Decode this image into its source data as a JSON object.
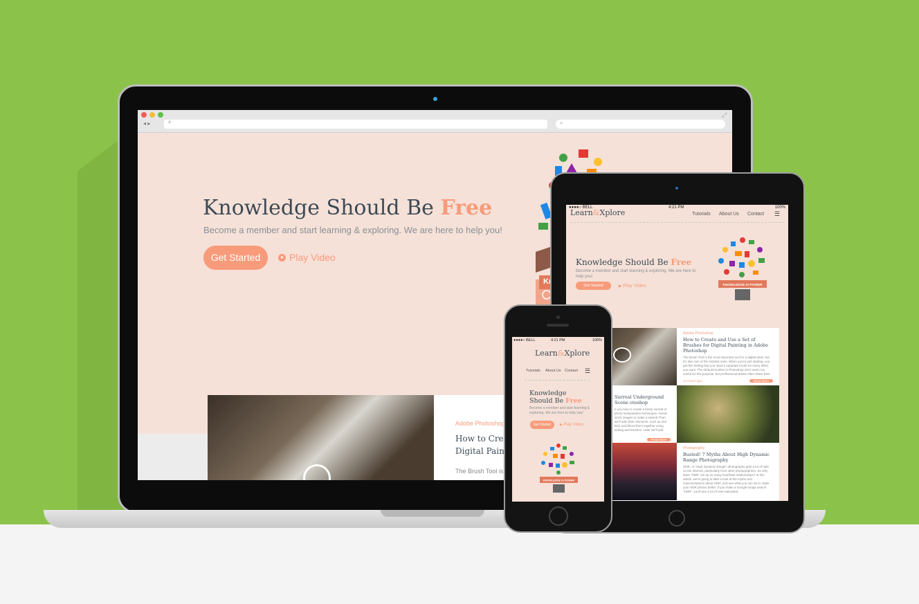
{
  "desktop": {
    "hero": {
      "title_main": "Knowledge Should Be ",
      "title_accent": "Free",
      "subtitle": "Become a member and start learning & exploring. We are here to help you!",
      "cta_label": "Get Started",
      "play_label": "Play Video"
    },
    "article": {
      "category": "Adobe Photoshop",
      "title_line1": "How to Crea",
      "title_line2": "Digital Paint",
      "excerpt": "The Brush Tool is t"
    },
    "badge": "Kn"
  },
  "tablet": {
    "status": {
      "carrier": "●●●●○ BELL",
      "time": "4:21 PM",
      "battery": "100%"
    },
    "logo_a": "Learn",
    "logo_amp": "&",
    "logo_b": "Xplore",
    "nav": [
      "Tutorials",
      "About Us",
      "Contact"
    ],
    "hero": {
      "title_main": "Knowledge Should Be ",
      "title_accent": "Free",
      "subtitle": "Become a member and start learning & exploring. We are here to help you!",
      "cta_label": "Get Started",
      "play_label": "Play Video",
      "badge": "KNOWLEDGE IS POWER"
    },
    "articles": [
      {
        "category": "Adobe Photoshop",
        "title": "How to Create and Use a Set of Brushes for Digital Painting in Adobe Photoshop",
        "excerpt": "The Brush Tool is the most important tool for a digital artist, but it's also one of the trickiest ones. When you're just starting, you get this feeling that you need a separate brush for every effect you want. The default brushes in Photoshop don't seem too useful for this purpose, but professional artists often share their palettes, so you can always download something more powerful.",
        "meta": "12 Hours ago",
        "more": "Read More"
      },
      {
        "category": "",
        "title": "Surreal Underground Scene otoshop",
        "excerpt": "e you how to create a funny surreal of photo manipulation techniques. everal stock images to make a natural Then we'll add other elements, such as sed bird, and blend them together using asking and brushes. Later we'll add",
        "meta": "",
        "more": "Read More"
      },
      {
        "category": "Photography",
        "title": "Busted! 7 Myths About High Dynamic Range Photography",
        "excerpt": "HDR, or \"High Dynamic Range\" photography gets a lot of hate on the internet, particularly from other photographers. So why does \"HDR\" stir up so many love/hate relationships? In this article, we're going to take a look at the myths and misconceptions about HDR, and see what you can do to make your HDR photos better. If you make a Google image search \"HDR\", you'll see a lot of over-saturated.",
        "meta": "",
        "more": ""
      }
    ]
  },
  "phone": {
    "status": {
      "carrier": "●●●●○ BELL",
      "time": "4:21 PM",
      "battery": "100%"
    },
    "logo_a": "Learn",
    "logo_amp": "&",
    "logo_b": "Xplore",
    "nav": [
      "Tutorials",
      "About Us",
      "Contact"
    ],
    "hero": {
      "title_main": "Knowledge Should Be ",
      "title_accent": "Free",
      "subtitle": "Become a member and start learning & exploring. We are here to help you!",
      "cta_label": "Get Started",
      "play_label": "Play Video",
      "badge": "KNOWLEDGE IS POWER"
    }
  },
  "colors": {
    "background": "#8bc34a",
    "page": "#f5e1d8",
    "accent": "#f79b7a",
    "text": "#3d4a55"
  }
}
